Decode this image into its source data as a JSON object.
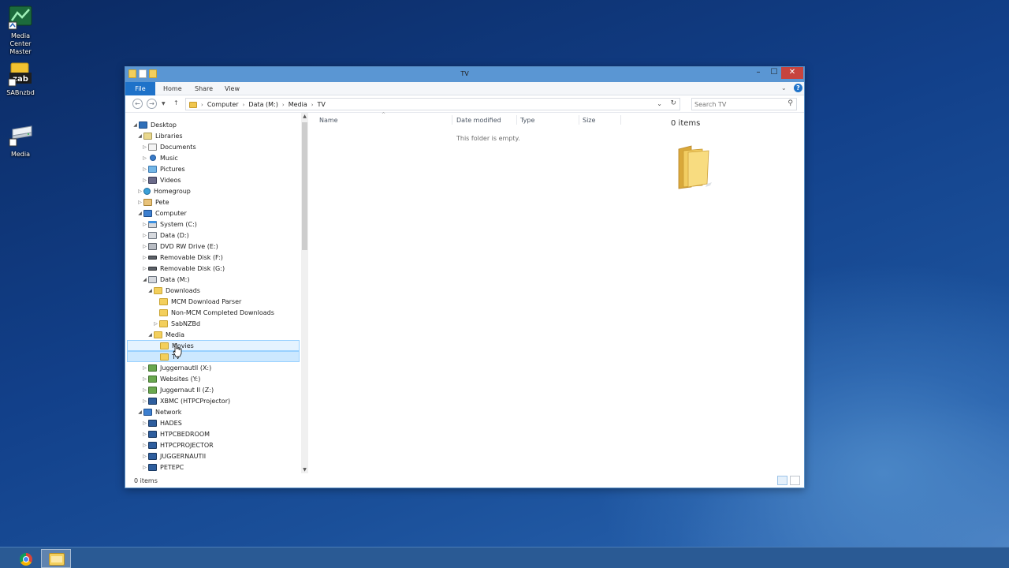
{
  "desktop": {
    "icons": [
      {
        "label": "Media Center Master"
      },
      {
        "label": "SABnzbd"
      },
      {
        "label": "Media"
      }
    ]
  },
  "window": {
    "title": "TV",
    "ribbon_tabs": [
      "File",
      "Home",
      "Share",
      "View"
    ],
    "controls": {
      "minimize": "–",
      "maximize": "☐",
      "close": "✕"
    },
    "help": "?"
  },
  "address": {
    "breadcrumbs": [
      "Computer",
      "Data (M:)",
      "Media",
      "TV"
    ],
    "search_placeholder": "Search TV"
  },
  "tree": {
    "items": [
      {
        "label": "Desktop"
      },
      {
        "label": "Libraries"
      },
      {
        "label": "Documents"
      },
      {
        "label": "Music"
      },
      {
        "label": "Pictures"
      },
      {
        "label": "Videos"
      },
      {
        "label": "Homegroup"
      },
      {
        "label": "Pete"
      },
      {
        "label": "Computer"
      },
      {
        "label": "System (C:)"
      },
      {
        "label": "Data (D:)"
      },
      {
        "label": "DVD RW Drive (E:)"
      },
      {
        "label": "Removable Disk (F:)"
      },
      {
        "label": "Removable Disk (G:)"
      },
      {
        "label": "Data (M:)"
      },
      {
        "label": "Downloads"
      },
      {
        "label": "MCM Download Parser"
      },
      {
        "label": "Non-MCM Completed Downloads"
      },
      {
        "label": "SabNZBd"
      },
      {
        "label": "Media"
      },
      {
        "label": "Movies"
      },
      {
        "label": "TV"
      },
      {
        "label": "Juggernautll (X:)"
      },
      {
        "label": "Websites (Y:)"
      },
      {
        "label": "Juggernaut II (Z:)"
      },
      {
        "label": "XBMC (HTPCProjector)"
      },
      {
        "label": "Network"
      },
      {
        "label": "HADES"
      },
      {
        "label": "HTPCBEDROOM"
      },
      {
        "label": "HTPCPROJECTOR"
      },
      {
        "label": "JUGGERNAUTII"
      },
      {
        "label": "PETEPC"
      }
    ]
  },
  "content": {
    "columns": [
      "Name",
      "Date modified",
      "Type",
      "Size"
    ],
    "empty_message": "This folder is empty."
  },
  "preview": {
    "item_count": "0 items"
  },
  "status": {
    "item_count": "0 items"
  },
  "colors": {
    "accent": "#1e72c9",
    "titlebar": "#5a96d3",
    "selection": "#cce8ff",
    "close": "#c7443e"
  }
}
